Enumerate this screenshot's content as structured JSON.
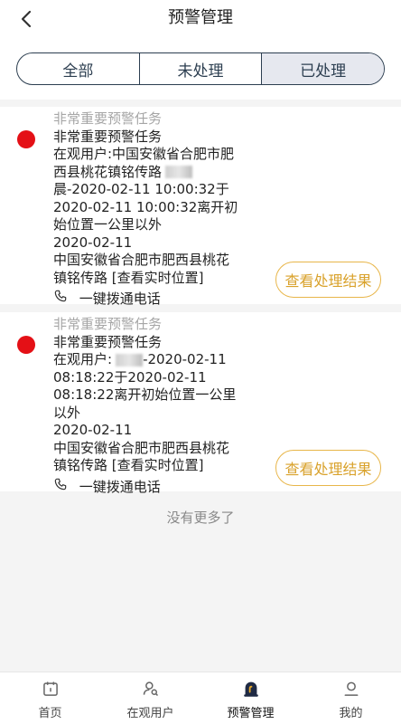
{
  "header": {
    "title": "预警管理"
  },
  "filter": {
    "tabs": [
      "全部",
      "未处理",
      "已处理"
    ],
    "active": "已处理"
  },
  "alerts": [
    {
      "category": "非常重要预警任务",
      "title": "非常重要预警任务",
      "lines": [
        "在观用户:中国安徽省合肥市肥",
        "西县桃花镇铭传路",
        "晨-2020-02-11 10:00:32于",
        "2020-02-11 10:00:32离开初",
        "始位置一公里以外",
        "2020-02-11",
        "中国安徽省合肥市肥西县桃花",
        "镇铭传路 [查看实时位置]"
      ],
      "dial_label": "一键拨通电话",
      "result_button": "查看处理结果",
      "status_color": "#e41016"
    },
    {
      "category": "非常重要预警任务",
      "title": "非常重要预警任务",
      "lines": [
        "在观用户:",
        "-2020-02-11",
        "08:18:22于2020-02-11",
        "08:18:22离开初始位置一公里",
        "以外",
        "2020-02-11",
        "中国安徽省合肥市肥西县桃花",
        "镇铭传路 [查看实时位置]"
      ],
      "dial_label": "一键拨通电话",
      "result_button": "查看处理结果",
      "status_color": "#e41016"
    }
  ],
  "footer_note": "没有更多了",
  "tabbar": [
    {
      "label": "首页",
      "icon": "calendar-icon"
    },
    {
      "label": "在观用户",
      "icon": "user-search-icon"
    },
    {
      "label": "预警管理",
      "icon": "alarm-icon"
    },
    {
      "label": "我的",
      "icon": "profile-icon"
    }
  ],
  "tabbar_active": "预警管理"
}
